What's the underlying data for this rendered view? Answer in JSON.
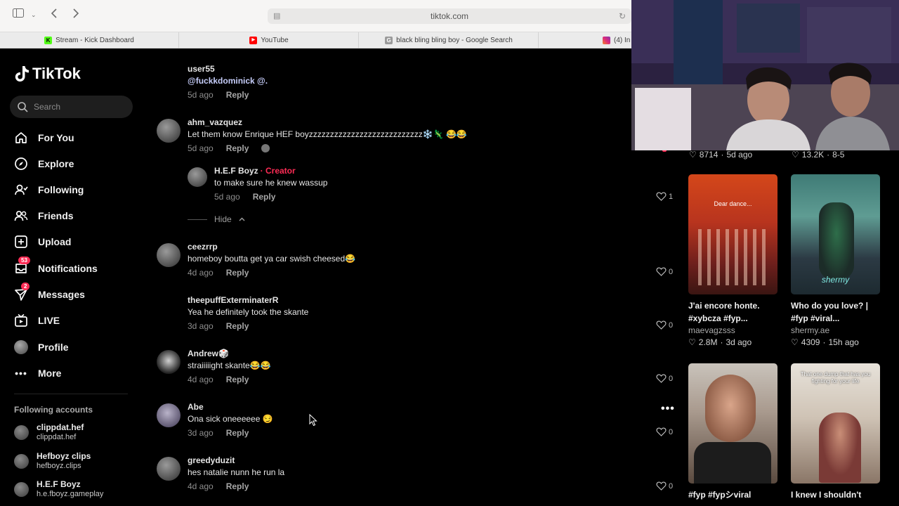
{
  "browser": {
    "url": "tiktok.com",
    "tabs": [
      {
        "label": "Stream - Kick Dashboard",
        "icon": "kick-icon",
        "color": "#53fc18"
      },
      {
        "label": "YouTube",
        "icon": "youtube-icon",
        "color": "#ff0000"
      },
      {
        "label": "black bling bling boy - Google Search",
        "icon": "google-icon",
        "color": "#777777"
      },
      {
        "label": "(4) In",
        "icon": "instagram-icon",
        "color": "#c13584"
      }
    ]
  },
  "sidebar": {
    "logo": "TikTok",
    "search_placeholder": "Search",
    "nav": [
      {
        "label": "For You",
        "icon": "home-icon"
      },
      {
        "label": "Explore",
        "icon": "compass-icon"
      },
      {
        "label": "Following",
        "icon": "following-icon"
      },
      {
        "label": "Friends",
        "icon": "friends-icon"
      },
      {
        "label": "Upload",
        "icon": "upload-icon"
      },
      {
        "label": "Notifications",
        "icon": "inbox-icon",
        "badge": "53"
      },
      {
        "label": "Messages",
        "icon": "send-icon",
        "badge": "2"
      },
      {
        "label": "LIVE",
        "icon": "live-icon"
      },
      {
        "label": "Profile",
        "icon": "avatar-icon"
      },
      {
        "label": "More",
        "icon": "more-icon"
      }
    ],
    "following_title": "Following accounts",
    "following": [
      {
        "name": "clippdat.hef",
        "handle": "clippdat.hef"
      },
      {
        "name": "Hefboyz clips",
        "handle": "hefboyz.clips"
      },
      {
        "name": "H.E.F Boyz",
        "handle": "h.e.fboyz.gameplay"
      }
    ]
  },
  "comments": [
    {
      "user": "user55",
      "text": "@fuckkdominick @.",
      "time": "5d ago",
      "reply": "Reply",
      "mention": true
    },
    {
      "user": "ahm_vazquez",
      "text": "Let them know Enrique HEF boyzzzzzzzzzzzzzzzzzzzzzzzzzzz❄️🦎 😂😂",
      "time": "5d ago",
      "reply": "Reply",
      "likes": "1"
    },
    {
      "user": "H.E.F Boyz",
      "creator": "· Creator",
      "text": "to make sure he knew wassup",
      "time": "5d ago",
      "reply": "Reply"
    },
    {
      "user": "ceezrrp",
      "text": "homeboy boutta get ya car swish cheesed😂",
      "time": "4d ago",
      "reply": "Reply",
      "likes": "0"
    },
    {
      "user": "theepuffExterminaterR",
      "text": "Yea he definitely took the skante",
      "time": "3d ago",
      "reply": "Reply",
      "likes": "0"
    },
    {
      "user": "Andrew🎲",
      "text": "straiiiiight skante😂😂",
      "time": "4d ago",
      "reply": "Reply",
      "likes": "0"
    },
    {
      "user": "Abe",
      "text": "Ona sick oneeeeee 😏",
      "time": "3d ago",
      "reply": "Reply",
      "likes": "0"
    },
    {
      "user": "greedyduzit",
      "text": "hes natalie nunn he run la",
      "time": "4d ago",
      "reply": "Reply",
      "likes": "0"
    }
  ],
  "hide_label": "Hide",
  "right": {
    "top_stats": [
      {
        "likes": "8714",
        "date": "5d ago"
      },
      {
        "likes": "13.2K",
        "date": "8-5"
      }
    ],
    "cards": [
      {
        "title": "J'ai encore honte. #xybcza #fyp...",
        "author": "maevagzsss",
        "likes": "2.8M",
        "date": "3d ago",
        "overlay": "Dear dance..."
      },
      {
        "title": "Who do you love? | #fyp #viral...",
        "author": "shermy.ae",
        "likes": "4309",
        "date": "15h ago",
        "overlay": "shermy"
      },
      {
        "title": "#fyp #fypシviral",
        "overlay": ""
      },
      {
        "title": "I knew I shouldn't",
        "overlay": "That one dump that has you fighting for your life"
      }
    ]
  }
}
